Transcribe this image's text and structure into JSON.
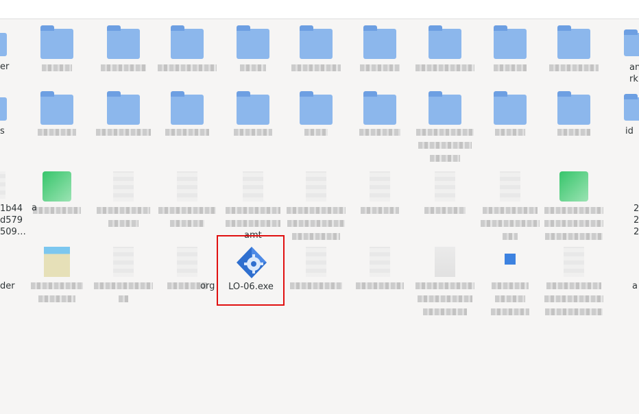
{
  "desktop": {
    "selected_item_label": "LO-06.exe",
    "left_edge_labels": [
      "er",
      "s",
      "1b44\nd579\n509…",
      "der"
    ],
    "right_edge_labels": [
      "an\nrkb",
      "id",
      "2\n2\n2",
      "a"
    ],
    "partial_labels": [
      "a",
      "amt",
      "org"
    ],
    "selected_icon": "gear-diamond-icon"
  },
  "colors": {
    "folder": "#8cb7ec",
    "folder_tab": "#6d9fe2",
    "selection_box": "#e01010",
    "exe_icon": "#2f6fcf"
  }
}
